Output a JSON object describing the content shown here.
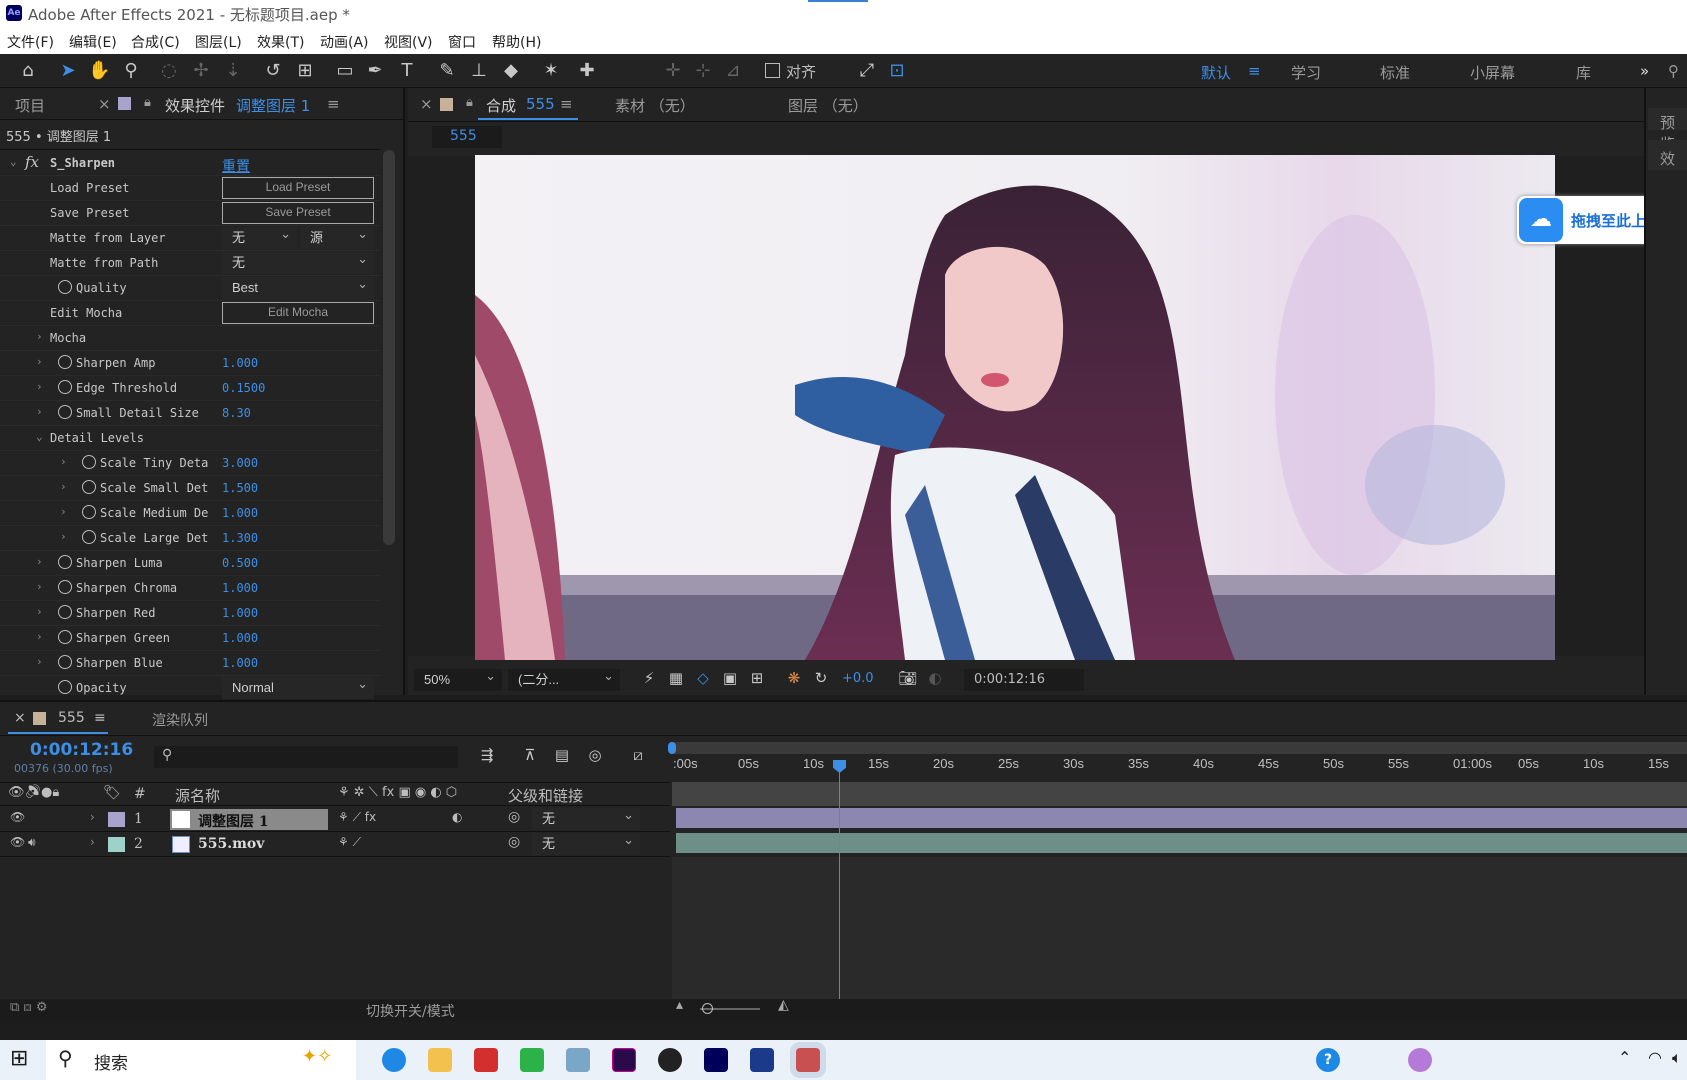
{
  "titlebar": {
    "title": "Adobe After Effects 2021 - 无标题项目.aep *",
    "logo": "Ae"
  },
  "menu": [
    "文件(F)",
    "编辑(E)",
    "合成(C)",
    "图层(L)",
    "效果(T)",
    "动画(A)",
    "视图(V)",
    "窗口",
    "帮助(H)"
  ],
  "toolbar": {
    "align_label": "对齐",
    "workspaces": [
      "默认",
      "学习",
      "标准",
      "小屏幕",
      "库"
    ],
    "icons": [
      "home-icon",
      "selection-icon",
      "hand-icon",
      "zoom-icon",
      "orbit-icon",
      "pan-icon",
      "dolly-icon",
      "rotate-icon",
      "anchor-icon",
      "rectangle-icon",
      "pen-icon",
      "text-icon",
      "brush-icon",
      "stamp-icon",
      "eraser-icon",
      "roto-icon",
      "puppet-icon"
    ]
  },
  "effects_panel": {
    "tab_project": "项目",
    "tab_effects": "效果控件",
    "tab_layer": "调整图层 1",
    "breadcrumb": "555 • 调整图层 1",
    "effect_name": "S_Sharpen",
    "reset": "重置",
    "props": [
      {
        "name": "Load Preset",
        "button": "Load Preset"
      },
      {
        "name": "Save Preset",
        "button": "Save Preset"
      },
      {
        "name": "Matte from Layer",
        "dd1": "无",
        "dd2": "源"
      },
      {
        "name": "Matte from Path",
        "dd1": "无"
      },
      {
        "name": "Quality",
        "dd1": "Best"
      },
      {
        "name": "Edit Mocha",
        "button": "Edit Mocha"
      },
      {
        "name": "Mocha"
      },
      {
        "name": "Sharpen Amp",
        "value": "1.000"
      },
      {
        "name": "Edge Threshold",
        "value": "0.1500"
      },
      {
        "name": "Small Detail Size",
        "value": "8.30"
      },
      {
        "name": "Detail Levels"
      },
      {
        "name": "Scale Tiny Deta",
        "value": "3.000"
      },
      {
        "name": "Scale Small Det",
        "value": "1.500"
      },
      {
        "name": "Scale Medium De",
        "value": "1.000"
      },
      {
        "name": "Scale Large Det",
        "value": "1.300"
      },
      {
        "name": "Sharpen Luma",
        "value": "0.500"
      },
      {
        "name": "Sharpen Chroma",
        "value": "1.000"
      },
      {
        "name": "Sharpen Red",
        "value": "1.000"
      },
      {
        "name": "Sharpen Green",
        "value": "1.000"
      },
      {
        "name": "Sharpen Blue",
        "value": "1.000"
      },
      {
        "name": "Opacity",
        "dd1": "Normal"
      }
    ]
  },
  "comp_panel": {
    "tab_comp": "合成",
    "comp_name": "555",
    "tab_footage": "素材 （无）",
    "tab_layer": "图层 （无）",
    "comp_chip": "555",
    "zoom": "50%",
    "resolution": "(二分...",
    "exposure": "+0.0",
    "timecode": "0:00:12:16"
  },
  "right_panel": {
    "preview": "预览",
    "effects": "效"
  },
  "upload_badge": "拖拽至此上传",
  "timeline": {
    "tab": "555",
    "render_queue": "渲染队列",
    "timecode": "0:00:12:16",
    "frames": "00376 (30.00 fps)",
    "col_hash": "#",
    "col_source": "源名称",
    "col_parent": "父级和链接",
    "ticks": [
      ":00s",
      "05s",
      "10s",
      "15s",
      "20s",
      "25s",
      "30s",
      "35s",
      "40s",
      "45s",
      "50s",
      "55s",
      "01:00s",
      "05s",
      "10s",
      "15s"
    ],
    "layers": [
      {
        "num": "1",
        "name": "调整图层 1",
        "parent": "无",
        "color": "#a7a3cc",
        "bar": "#8c87b0"
      },
      {
        "num": "2",
        "name": "555.mov",
        "parent": "无",
        "color": "#9ed1c8",
        "bar": "#6d8f87"
      }
    ],
    "toggle": "切换开关/模式"
  },
  "taskbar": {
    "search": "搜索"
  }
}
